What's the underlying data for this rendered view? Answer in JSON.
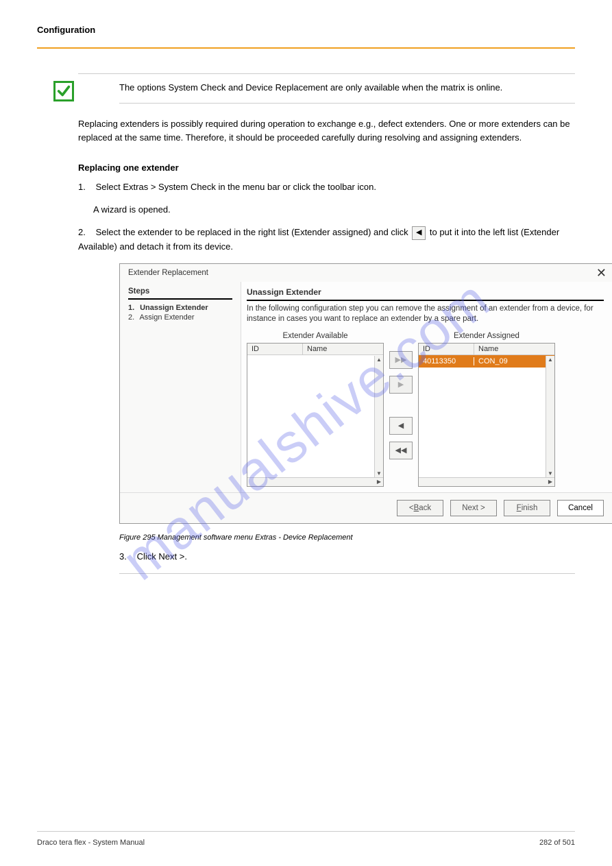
{
  "header": {
    "title": "Configuration"
  },
  "note": {
    "text": "The options System Check and Device Replacement are only available when the matrix is online."
  },
  "intro": {
    "text": "Replacing extenders is possibly required during operation to exchange e.g., defect extenders. One or more extenders can be replaced at the same time. Therefore, it should be proceeded carefully during resolving and assigning extenders."
  },
  "replace_heading": "Replacing one extender",
  "steps": {
    "s1": {
      "num": "1.",
      "text": "Select Extras > System Check in the menu bar or click the toolbar icon."
    },
    "s1_sub": "A wizard is opened.",
    "s2_pre": "Select the extender to be replaced in the right list (Extender assigned) and click",
    "s2_post": "to put it into the left list (Extender Available) and detach it from its device.",
    "s2_num": "2.",
    "s3": {
      "num": "3.",
      "text": "Click Next >."
    }
  },
  "dialog": {
    "title": "Extender Replacement",
    "steps_heading": "Steps",
    "steps_items": [
      {
        "n": "1.",
        "label": "Unassign Extender",
        "active": true
      },
      {
        "n": "2.",
        "label": "Assign Extender",
        "active": false
      }
    ],
    "right_heading": "Unassign Extender",
    "description": "In the following configuration step you can remove the assignment of an extender from a device, for instance in cases you want to replace an extender by a spare part.",
    "avail_title": "Extender Available",
    "assigned_title": "Extender Assigned",
    "cols": {
      "id": "ID",
      "name": "Name"
    },
    "assigned_rows": [
      {
        "id": "40113350",
        "name": "CON_09"
      }
    ],
    "buttons": {
      "back": "< Back",
      "next": "Next >",
      "finish": "Finish",
      "cancel": "Cancel"
    }
  },
  "figure_caption": "Figure 295 Management software menu Extras - Device Replacement",
  "page_footer": {
    "left": "Draco tera flex - System Manual",
    "right": "282 of 501"
  },
  "watermark": "manualshive.com"
}
